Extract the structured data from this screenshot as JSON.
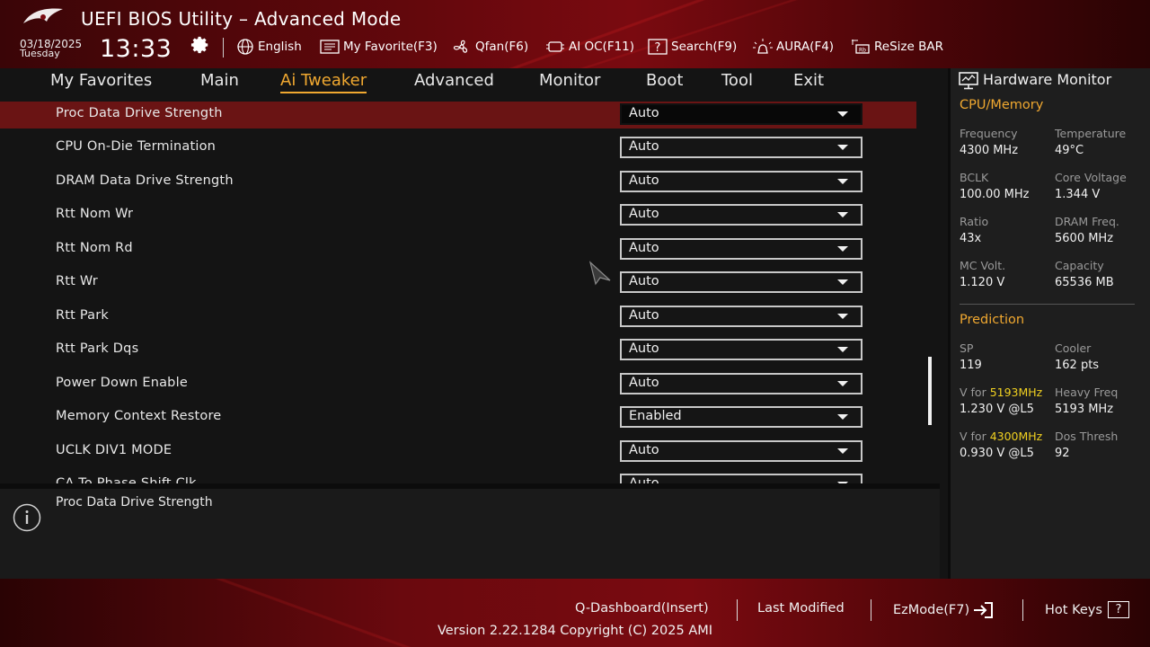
{
  "header": {
    "title": "UEFI BIOS Utility – Advanced Mode",
    "date": "03/18/2025",
    "weekday": "Tuesday",
    "time": "13:33",
    "tools": [
      {
        "label": "English",
        "icon": "globe-icon"
      },
      {
        "label": "My Favorite(F3)",
        "icon": "favorite-list-icon"
      },
      {
        "label": "Qfan(F6)",
        "icon": "fan-icon"
      },
      {
        "label": "AI OC(F11)",
        "icon": "ai-chip-icon"
      },
      {
        "label": "Search(F9)",
        "icon": "search-help-icon"
      },
      {
        "label": "AURA(F4)",
        "icon": "aura-light-icon"
      },
      {
        "label": "ReSize BAR",
        "icon": "resize-bar-icon"
      }
    ]
  },
  "tabs": [
    {
      "label": "My Favorites",
      "active": false
    },
    {
      "label": "Main",
      "active": false
    },
    {
      "label": "Ai Tweaker",
      "active": true
    },
    {
      "label": "Advanced",
      "active": false
    },
    {
      "label": "Monitor",
      "active": false
    },
    {
      "label": "Boot",
      "active": false
    },
    {
      "label": "Tool",
      "active": false
    },
    {
      "label": "Exit",
      "active": false
    }
  ],
  "settings": [
    {
      "label": "Proc Data Drive Strength",
      "value": "Auto",
      "selected": true
    },
    {
      "label": "CPU On-Die Termination",
      "value": "Auto"
    },
    {
      "label": "DRAM Data Drive Strength",
      "value": "Auto"
    },
    {
      "label": "Rtt Nom Wr",
      "value": "Auto"
    },
    {
      "label": "Rtt Nom Rd",
      "value": "Auto"
    },
    {
      "label": "Rtt Wr",
      "value": "Auto"
    },
    {
      "label": "Rtt Park",
      "value": "Auto"
    },
    {
      "label": "Rtt Park Dqs",
      "value": "Auto"
    },
    {
      "label": "Power Down Enable",
      "value": "Auto"
    },
    {
      "label": "Memory Context Restore",
      "value": "Enabled"
    },
    {
      "label": "UCLK DIV1 MODE",
      "value": "Auto"
    },
    {
      "label": "CA To Phase Shift Clk",
      "value": "Auto"
    }
  ],
  "help": {
    "text": "Proc Data Drive Strength"
  },
  "hardware_monitor": {
    "title": "Hardware Monitor",
    "cpu_memory": {
      "heading": "CPU/Memory",
      "items": [
        {
          "key": "Frequency",
          "value": "4300 MHz"
        },
        {
          "key": "Temperature",
          "value": "49°C"
        },
        {
          "key": "BCLK",
          "value": "100.00 MHz"
        },
        {
          "key": "Core Voltage",
          "value": "1.344 V"
        },
        {
          "key": "Ratio",
          "value": "43x"
        },
        {
          "key": "DRAM Freq.",
          "value": "5600 MHz"
        },
        {
          "key": "MC Volt.",
          "value": "1.120 V"
        },
        {
          "key": "Capacity",
          "value": "65536 MB"
        }
      ]
    },
    "prediction": {
      "heading": "Prediction",
      "sp_key": "SP",
      "sp_value": "119",
      "cooler_key": "Cooler",
      "cooler_value": "162 pts",
      "v1_prefix": "V for ",
      "v1_freq": "5193MHz",
      "v1_value": "1.230 V @L5",
      "heavy_key": "Heavy Freq",
      "heavy_value": "5193 MHz",
      "v2_prefix": "V for ",
      "v2_freq": "4300MHz",
      "v2_value": "0.930 V @L5",
      "dos_key": "Dos Thresh",
      "dos_value": "92"
    }
  },
  "footer": {
    "q_dashboard": "Q-Dashboard(Insert)",
    "last_modified": "Last Modified",
    "ezmode": "EzMode(F7)",
    "hotkeys": "Hot Keys",
    "hotkeys_glyph": "?",
    "version": "Version 2.22.1284 Copyright (C) 2025 AMI"
  },
  "colors": {
    "accent": "#f0a830",
    "highlight": "#f0d020",
    "selected_row": "#6a1414",
    "header_red": "#7a0a10"
  }
}
